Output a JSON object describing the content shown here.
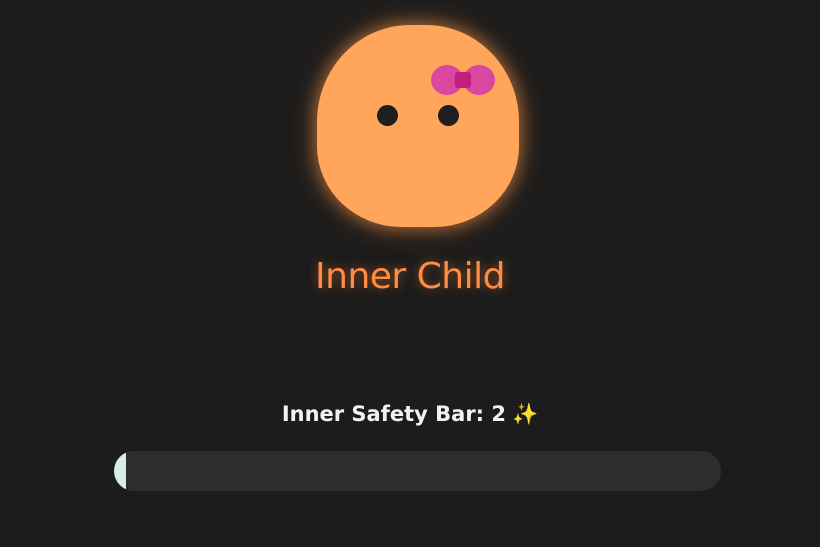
{
  "character": {
    "name": "Inner Child",
    "icon": "face-with-bow-icon",
    "body_color": "#ffa65a",
    "bow_color": "#d63fa6"
  },
  "safety": {
    "label": "Inner Safety Bar: 2",
    "sparkle": "✨",
    "value": 2,
    "max": 100,
    "fill_color": "#d6ece4",
    "track_color": "#2d2d2d"
  },
  "colors": {
    "background": "#1c1c1c",
    "accent": "#ff8c42"
  }
}
